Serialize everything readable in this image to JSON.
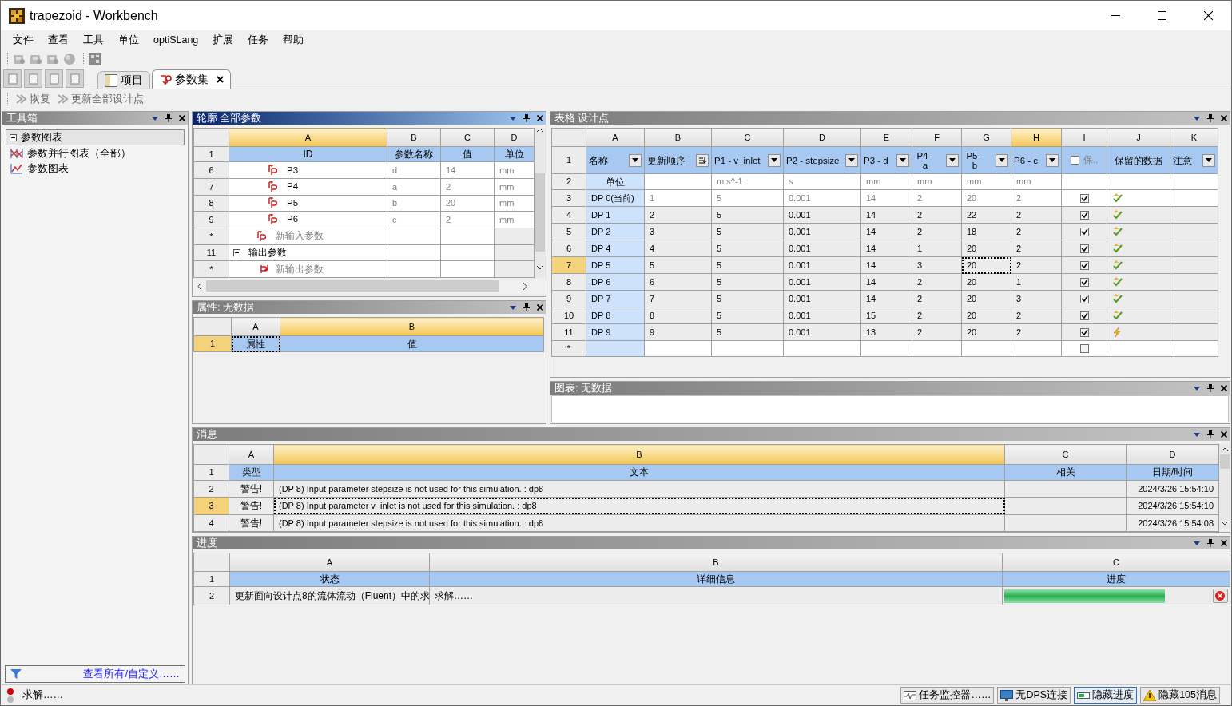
{
  "window": {
    "title": "trapezoid - Workbench"
  },
  "menu": [
    "文件",
    "查看",
    "工具",
    "单位",
    "optiSLang",
    "扩展",
    "任务",
    "帮助"
  ],
  "tabs": [
    {
      "label": "项目",
      "selected": false
    },
    {
      "label": "参数集",
      "selected": true
    }
  ],
  "actions": [
    {
      "label": "恢复",
      "disabled": true
    },
    {
      "label": "更新全部设计点",
      "disabled": true
    }
  ],
  "toolbox": {
    "title": "工具箱",
    "tree": [
      {
        "label": "参数图表",
        "expanded": true,
        "children": [
          {
            "label": "参数并行图表（全部）",
            "kind": "parallel"
          },
          {
            "label": "参数图表",
            "kind": "chart"
          }
        ]
      }
    ],
    "filter_link": "查看所有/自定义……"
  },
  "outline": {
    "title": "轮廓 全部参数",
    "active": true,
    "columns": [
      {
        "letter": "A",
        "selected": true
      },
      {
        "letter": "B",
        "selected": false
      },
      {
        "letter": "C",
        "selected": false
      },
      {
        "letter": "D",
        "selected": false
      }
    ],
    "header": {
      "row": "1",
      "cells": [
        "ID",
        "参数名称",
        "值",
        "单位"
      ]
    },
    "rows": [
      {
        "row": "6",
        "kind": "input",
        "id": "P3",
        "name": "d",
        "value": "14",
        "unit": "mm"
      },
      {
        "row": "7",
        "kind": "input",
        "id": "P4",
        "name": "a",
        "value": "2",
        "unit": "mm"
      },
      {
        "row": "8",
        "kind": "input",
        "id": "P5",
        "name": "b",
        "value": "20",
        "unit": "mm"
      },
      {
        "row": "9",
        "kind": "input",
        "id": "P6",
        "name": "c",
        "value": "2",
        "unit": "mm"
      },
      {
        "row": "*",
        "kind": "new_input",
        "id": "新输入参数"
      },
      {
        "row": "11",
        "kind": "group",
        "id": "输出参数",
        "expanded": true
      },
      {
        "row": "*",
        "kind": "new_output",
        "id": "新输出参数"
      }
    ]
  },
  "properties": {
    "title": "属性: 无数据",
    "active": false,
    "columns": [
      {
        "letter": "A",
        "selected": false
      },
      {
        "letter": "B",
        "selected": true
      }
    ],
    "rows": [
      {
        "row": "1",
        "selected": true,
        "cells": [
          "属性",
          "值"
        ]
      }
    ]
  },
  "design_points": {
    "title": "表格 设计点",
    "active": false,
    "columns": [
      {
        "letter": "A",
        "selected": false
      },
      {
        "letter": "B",
        "selected": false
      },
      {
        "letter": "C",
        "selected": false
      },
      {
        "letter": "D",
        "selected": false
      },
      {
        "letter": "E",
        "selected": false
      },
      {
        "letter": "F",
        "selected": false
      },
      {
        "letter": "G",
        "selected": false
      },
      {
        "letter": "H",
        "selected": true
      },
      {
        "letter": "I",
        "selected": false
      },
      {
        "letter": "J",
        "selected": false
      },
      {
        "letter": "K",
        "selected": false
      }
    ],
    "header": {
      "row": "1",
      "cells": [
        {
          "label": "名称",
          "kind": "dropdown"
        },
        {
          "label": "更新顺序",
          "kind": "sort"
        },
        {
          "label": "P1 - v_inlet",
          "kind": "dropdown"
        },
        {
          "label": "P2 - stepsize",
          "kind": "dropdown"
        },
        {
          "label": "P3 - d",
          "kind": "dropdown"
        },
        {
          "label": "P4 - a",
          "kind": "dropdown"
        },
        {
          "label": "P5 - b",
          "kind": "dropdown"
        },
        {
          "label": "P6 - c",
          "kind": "dropdown"
        },
        {
          "label": "保..",
          "kind": "checkbox",
          "checked": false
        },
        {
          "label": "保留的数据",
          "kind": "plain"
        },
        {
          "label": "注意",
          "kind": "dropdown"
        }
      ]
    },
    "units": {
      "row": "2",
      "label": "单位",
      "cells": [
        "m s^-1",
        "s",
        "mm",
        "mm",
        "mm",
        "mm"
      ]
    },
    "rows": [
      {
        "row": "3",
        "name": "DP 0(当前)",
        "current": true,
        "selected": false,
        "order": "1",
        "values": [
          "5",
          "0.001",
          "14",
          "2",
          "20",
          "2"
        ],
        "retain": true,
        "up_to_date": true
      },
      {
        "row": "4",
        "name": "DP 1",
        "current": false,
        "selected": false,
        "order": "2",
        "values": [
          "5",
          "0.001",
          "14",
          "2",
          "22",
          "2"
        ],
        "retain": true,
        "up_to_date": true
      },
      {
        "row": "5",
        "name": "DP 2",
        "current": false,
        "selected": false,
        "order": "3",
        "values": [
          "5",
          "0.001",
          "14",
          "2",
          "18",
          "2"
        ],
        "retain": true,
        "up_to_date": true
      },
      {
        "row": "6",
        "name": "DP 4",
        "current": false,
        "selected": false,
        "order": "4",
        "values": [
          "5",
          "0.001",
          "14",
          "1",
          "20",
          "2"
        ],
        "retain": true,
        "up_to_date": true
      },
      {
        "row": "7",
        "name": "DP 5",
        "current": false,
        "selected": true,
        "order": "5",
        "values": [
          "5",
          "0.001",
          "14",
          "3",
          "20",
          "2"
        ],
        "retain": true,
        "up_to_date": true
      },
      {
        "row": "8",
        "name": "DP 6",
        "current": false,
        "selected": false,
        "order": "6",
        "values": [
          "5",
          "0.001",
          "14",
          "2",
          "20",
          "1"
        ],
        "retain": true,
        "up_to_date": true
      },
      {
        "row": "9",
        "name": "DP 7",
        "current": false,
        "selected": false,
        "order": "7",
        "values": [
          "5",
          "0.001",
          "14",
          "2",
          "20",
          "3"
        ],
        "retain": true,
        "up_to_date": true
      },
      {
        "row": "10",
        "name": "DP 8",
        "current": false,
        "selected": false,
        "order": "8",
        "values": [
          "5",
          "0.001",
          "15",
          "2",
          "20",
          "2"
        ],
        "retain": true,
        "up_to_date": true
      },
      {
        "row": "11",
        "name": "DP 9",
        "current": false,
        "selected": false,
        "order": "9",
        "values": [
          "5",
          "0.001",
          "13",
          "2",
          "20",
          "2"
        ],
        "retain": true,
        "up_to_date": false
      }
    ],
    "new_row": {
      "row": "*",
      "retain": false
    }
  },
  "chart_panel": {
    "title": "图表: 无数据",
    "active": false
  },
  "messages": {
    "title": "消息",
    "active": false,
    "columns": [
      {
        "letter": "A",
        "selected": false
      },
      {
        "letter": "B",
        "selected": true
      },
      {
        "letter": "C",
        "selected": false
      },
      {
        "letter": "D",
        "selected": false
      }
    ],
    "header": {
      "row": "1",
      "cells": [
        "类型",
        "文本",
        "相关",
        "日期/时间"
      ]
    },
    "rows": [
      {
        "row": "2",
        "selected": false,
        "type": "警告!",
        "text": "(DP 8) Input parameter stepsize is not used for this simulation. : dp8",
        "time": "2024/3/26 15:54:10"
      },
      {
        "row": "3",
        "selected": true,
        "type": "警告!",
        "text": "(DP 8) Input parameter v_inlet is not used for this simulation. : dp8",
        "time": "2024/3/26 15:54:10"
      },
      {
        "row": "4",
        "selected": false,
        "type": "警告!",
        "text": "(DP 8) Input parameter stepsize is not used for this simulation. : dp8",
        "time": "2024/3/26 15:54:08"
      }
    ]
  },
  "progress": {
    "title": "进度",
    "active": false,
    "columns": [
      {
        "letter": "A",
        "selected": false
      },
      {
        "letter": "B",
        "selected": false
      },
      {
        "letter": "C",
        "selected": false
      }
    ],
    "header": {
      "row": "1",
      "cells": [
        "状态",
        "详细信息",
        "进度"
      ]
    },
    "rows": [
      {
        "row": "2",
        "status": "更新面向设计点8的流体流动（Fluent）中的求",
        "detail": "求解……",
        "level": 0.77
      }
    ]
  },
  "status_bar": {
    "text": "求解……",
    "buttons": [
      {
        "label": "任务监控器……",
        "kind": "monitor",
        "selected": false
      },
      {
        "label": "无DPS连接",
        "kind": "dps",
        "selected": false
      },
      {
        "label": "隐藏进度",
        "kind": "progress",
        "selected": true
      },
      {
        "label": "隐藏105消息",
        "kind": "messages",
        "selected": false
      }
    ]
  }
}
